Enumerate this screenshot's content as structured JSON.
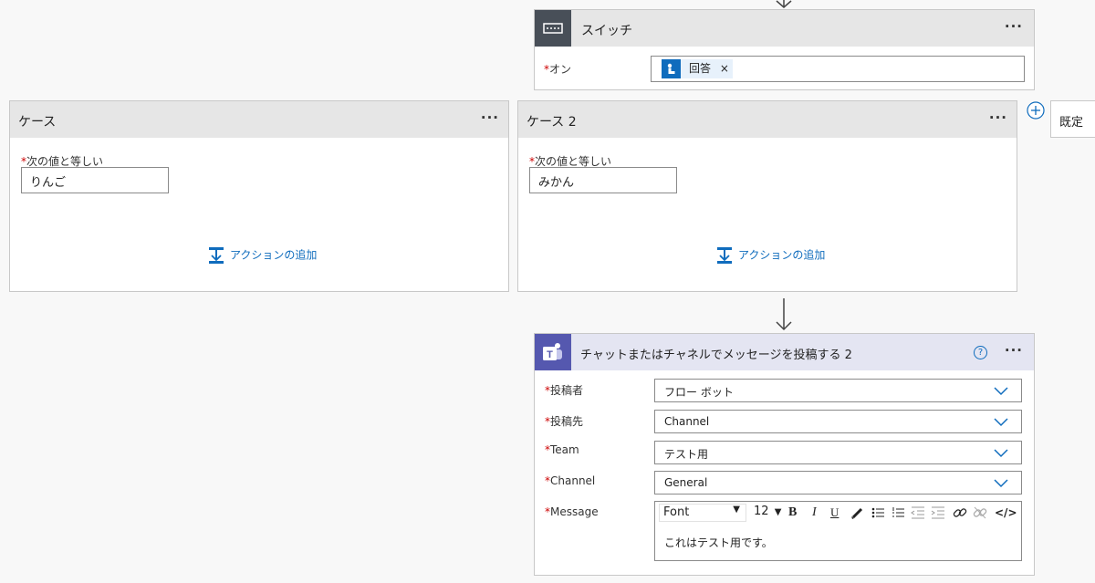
{
  "switch": {
    "title": "スイッチ",
    "more_label": "···",
    "on_label": "オン",
    "token_label": "回答",
    "token_remove": "×",
    "required_mark": "*"
  },
  "case1": {
    "title": "ケース",
    "more_label": "···",
    "equals_label": "次の値と等しい",
    "value": "りんご",
    "add_action": "アクションの追加"
  },
  "case2": {
    "title": "ケース 2",
    "more_label": "···",
    "equals_label": "次の値と等しい",
    "value": "みかん",
    "add_action": "アクションの追加"
  },
  "default_case": {
    "title": "既定",
    "add_icon": "plus-circle-icon"
  },
  "teams": {
    "title": "チャットまたはチャネルでメッセージを投稿する 2",
    "more_label": "···",
    "help_label": "?",
    "accent_color": "#5558af",
    "fields": {
      "post_as": {
        "label": "投稿者",
        "value": "フロー ボット"
      },
      "post_in": {
        "label": "投稿先",
        "value": "Channel"
      },
      "team": {
        "label": "Team",
        "value": "テスト用"
      },
      "channel": {
        "label": "Channel",
        "value": "General"
      },
      "message": {
        "label": "Message",
        "value": "これはテスト用です。"
      }
    },
    "toolbar": {
      "font": "Font",
      "size": "12",
      "bold": "B",
      "italic": "I",
      "underline": "U",
      "code": "</>"
    }
  },
  "colors": {
    "link_blue": "#0f6cbd",
    "required_red": "#cc0000",
    "switch_icon_bg": "#484f58",
    "header_gray": "#e6e6e6"
  }
}
